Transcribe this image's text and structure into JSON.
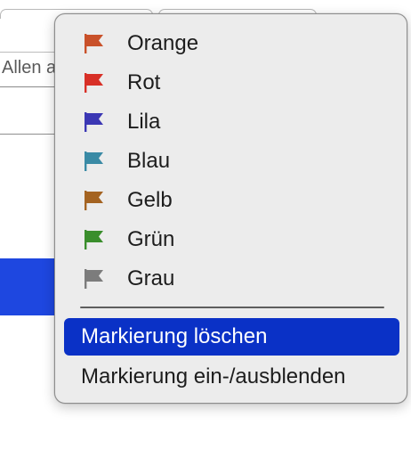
{
  "background": {
    "field_text": "Allen a"
  },
  "menu": {
    "flags": [
      {
        "label": "Orange",
        "color": "#c9512a"
      },
      {
        "label": "Rot",
        "color": "#d83027"
      },
      {
        "label": "Lila",
        "color": "#3b37b4"
      },
      {
        "label": "Blau",
        "color": "#3a8aa5"
      },
      {
        "label": "Gelb",
        "color": "#a46321"
      },
      {
        "label": "Grün",
        "color": "#3a8e2c"
      },
      {
        "label": "Grau",
        "color": "#7c7c7c"
      }
    ],
    "clear_label": "Markierung löschen",
    "toggle_label": "Markierung ein-/ausblenden"
  },
  "colors": {
    "highlight": "#0a31c6",
    "accent_background": "#1e47e0"
  }
}
